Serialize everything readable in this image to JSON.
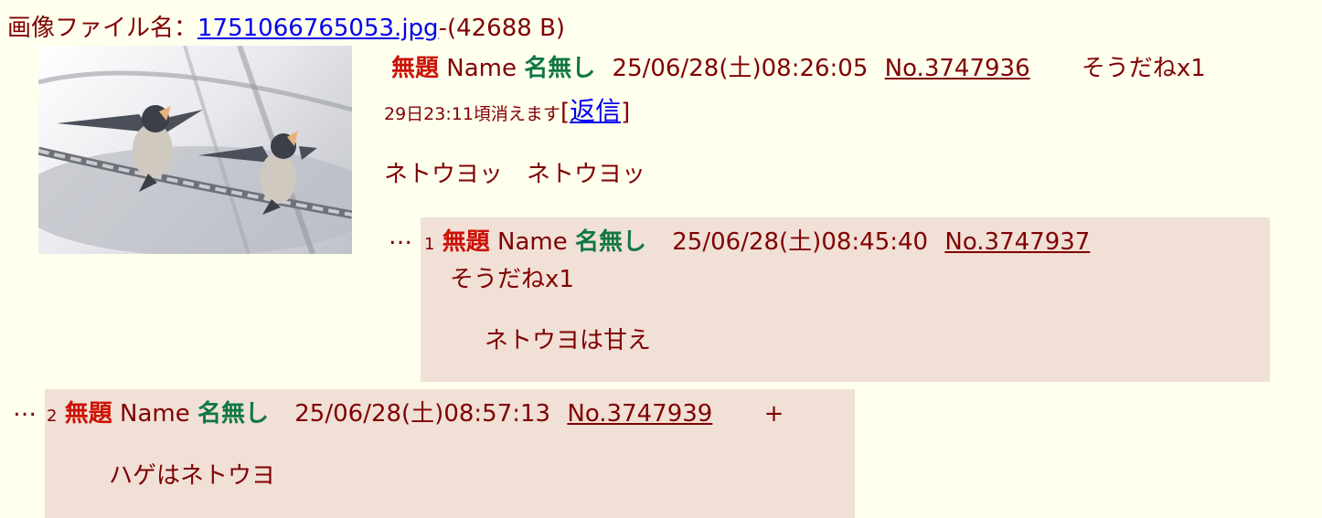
{
  "op": {
    "file_label": "画像ファイル名：",
    "file_name": "1751066765053.jpg",
    "file_sep": "-",
    "file_size": "(42688 B)",
    "subject": "無題",
    "name_label": "Name",
    "poster": "名無し",
    "datetime": "25/06/28(土)08:26:05",
    "number": "No.3747936",
    "sodane": "そうだねx1",
    "expire": "29日23:11頃消えます",
    "reply_open": "[",
    "reply_link": "返信",
    "reply_close": "]",
    "comment": "ネトウヨッ　ネトウヨッ"
  },
  "replies": [
    {
      "prefix": "…",
      "index": "1",
      "subject": "無題",
      "name_label": "Name",
      "poster": "名無し",
      "datetime": "25/06/28(土)08:45:40",
      "number": "No.3747937",
      "sodane": "そうだねx1",
      "comment": "ネトウヨは甘え"
    },
    {
      "prefix": "…",
      "index": "2",
      "subject": "無題",
      "name_label": "Name",
      "poster": "名無し",
      "datetime": "25/06/28(土)08:57:13",
      "number": "No.3747939",
      "sodane": "+",
      "comment": "ハゲはネトウヨ"
    }
  ]
}
